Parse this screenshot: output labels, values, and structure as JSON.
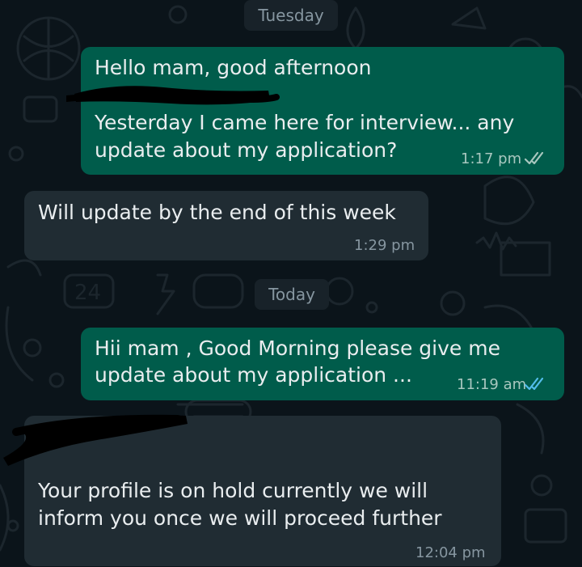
{
  "theme": {
    "background": "#0b141a",
    "outgoing_bubble": "#005c4b",
    "incoming_bubble": "#202c33",
    "date_pill": "#182229",
    "read_tick_color": "#53bdeb",
    "delivered_tick_color": "#a8c7bf"
  },
  "chat": {
    "day_separators": [
      "Tuesday",
      "Today"
    ],
    "messages": [
      {
        "direction": "outgoing",
        "lines": [
          "Hello mam, good afternoon",
          "Yesterday I came here for interview... any",
          "update about my application?"
        ],
        "time": "1:17 pm",
        "status": "double-tick-icon"
      },
      {
        "direction": "incoming",
        "lines": [
          "Will update by the end of this week"
        ],
        "time": "1:29 pm"
      },
      {
        "direction": "outgoing",
        "lines": [
          "Hii mam , Good Morning please give me",
          "update about my application ..."
        ],
        "time": "11:19 am",
        "status": "double-tick-read-icon"
      },
      {
        "direction": "incoming",
        "lines": [
          "Your profile is on hold currently we will",
          "inform you once we will proceed further"
        ],
        "time": "12:04 pm"
      }
    ]
  }
}
